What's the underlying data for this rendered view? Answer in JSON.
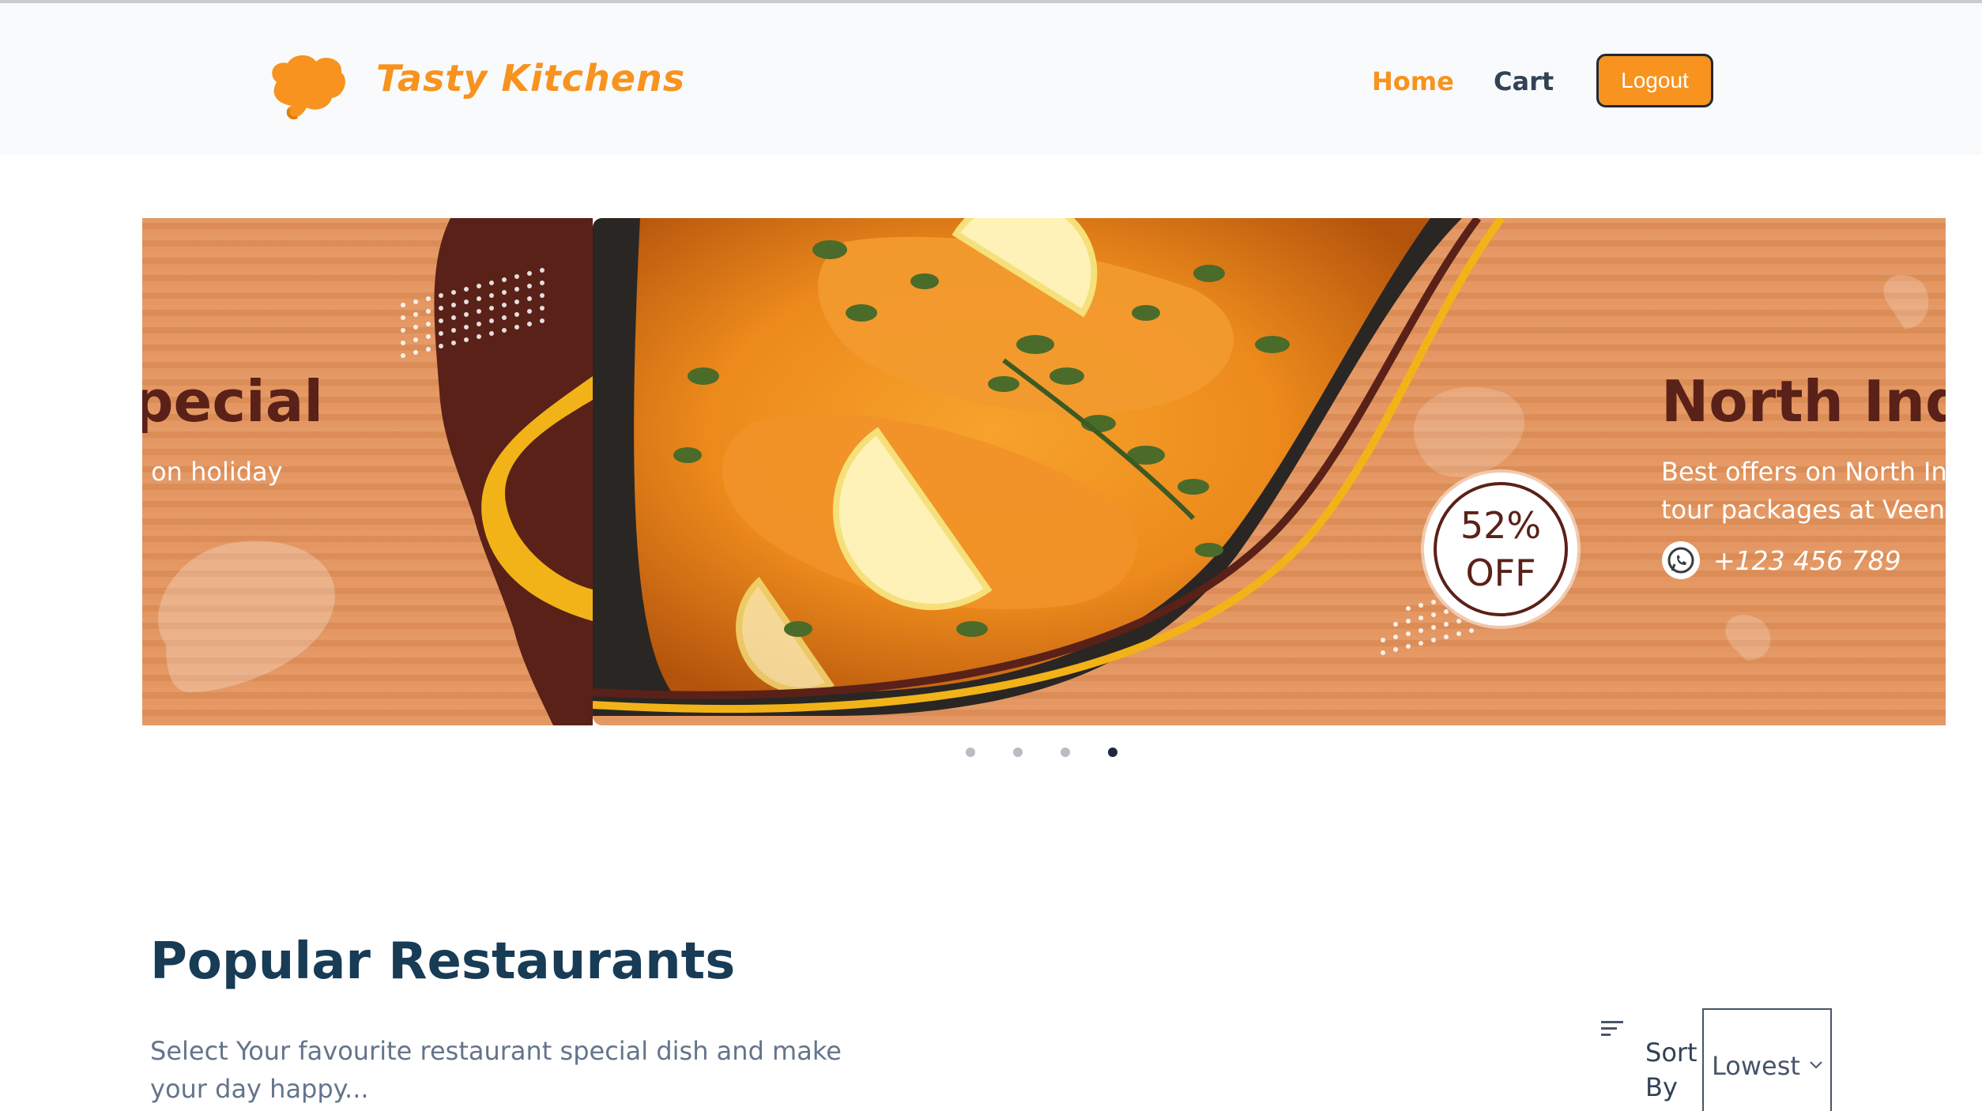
{
  "header": {
    "brand": "Tasty Kitchens",
    "nav": {
      "home": "Home",
      "cart": "Cart"
    },
    "logout": "Logout",
    "accent_color": "#f7931e"
  },
  "carousel": {
    "left_slide": {
      "title": "pecial",
      "subtitle": "l on holiday"
    },
    "main_slide": {
      "title": "North Indian Sp",
      "subtitle_line1": "Best offers on North Indian Specials",
      "subtitle_line2": "tour packages at Veena World.",
      "phone": "+123 456 789",
      "offer_percent": "52%",
      "offer_text": "OFF"
    },
    "dots_total": 4,
    "active_dot": 4
  },
  "section": {
    "title": "Popular Restaurants",
    "description": "Select Your favourite restaurant special dish and make your day happy...",
    "sort": {
      "label": "Sort By",
      "value": "Lowest"
    }
  }
}
